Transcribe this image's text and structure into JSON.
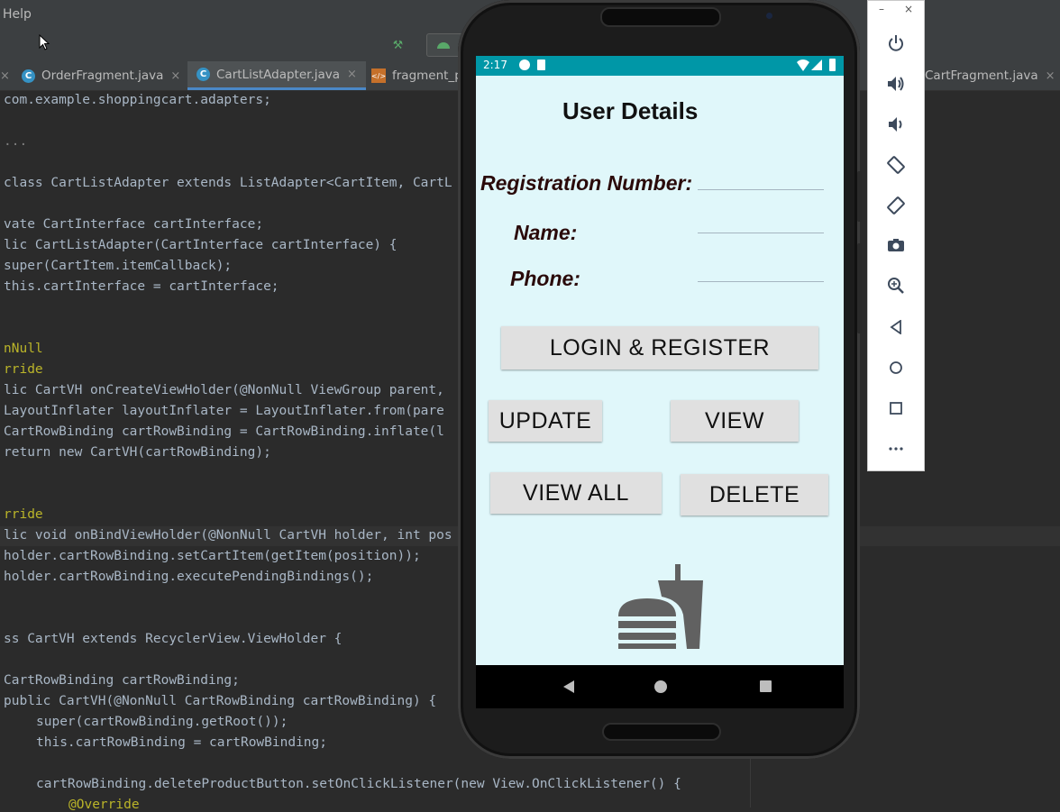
{
  "ide": {
    "menu": {
      "help": "Help"
    },
    "tabs": [
      {
        "label": "OrderFragment.java",
        "active": false
      },
      {
        "label": "CartListAdapter.java",
        "active": true
      },
      {
        "label": "fragment_p",
        "active": false
      }
    ],
    "tab_right": {
      "label": "CartFragment.java"
    },
    "code": [
      "com.example.shoppingcart.adapters;",
      "...",
      "class CartListAdapter extends ListAdapter<CartItem, CartL",
      "vate CartInterface cartInterface;",
      "lic CartListAdapter(CartInterface cartInterface) {",
      "super(CartItem.itemCallback);",
      "this.cartInterface = cartInterface;",
      "nNull",
      "rride",
      "lic CartVH onCreateViewHolder(@NonNull ViewGroup parent,",
      "LayoutInflater layoutInflater = LayoutInflater.from(pare",
      "CartRowBinding cartRowBinding = CartRowBinding.inflate(l",
      "return new CartVH(cartRowBinding);",
      "rride",
      "lic void onBindViewHolder(@NonNull CartVH holder, int pos",
      "holder.cartRowBinding.setCartItem(getItem(position));",
      "holder.cartRowBinding.executePendingBindings();",
      "ss CartVH extends RecyclerView.ViewHolder {",
      "CartRowBinding cartRowBinding;",
      "public CartVH(@NonNull CartRowBinding cartRowBinding) {",
      "super(cartRowBinding.getRoot());",
      "this.cartRowBinding = cartRowBinding;",
      "cartRowBinding.deleteProductButton.setOnClickListener(new View.OnClickListener() {",
      "@Override"
    ]
  },
  "phone": {
    "status_time": "2:17",
    "title": "User Details",
    "labels": {
      "registration": "Registration Number:",
      "name": "Name:",
      "phone": "Phone:"
    },
    "inputs": {
      "registration": "",
      "name": "",
      "phone": ""
    },
    "buttons": {
      "login_register": "LOGIN & REGISTER",
      "update": "UPDATE",
      "view": "VIEW",
      "view_all": "VIEW ALL",
      "delete": "DELETE"
    },
    "logo_icon": "fastfood-icon",
    "accent": "#0097a7",
    "background": "#e0f7fa"
  },
  "emulator_panel": {
    "window_controls": {
      "minimize": "–",
      "close": "×"
    },
    "buttons": [
      {
        "name": "power-icon",
        "glyph": "⏻"
      },
      {
        "name": "volume-up-icon",
        "glyph": "🔊"
      },
      {
        "name": "volume-down-icon",
        "glyph": "🔉"
      },
      {
        "name": "rotate-left-icon",
        "glyph": "⟲"
      },
      {
        "name": "rotate-right-icon",
        "glyph": "⟳"
      },
      {
        "name": "camera-icon",
        "glyph": "📷"
      },
      {
        "name": "zoom-icon",
        "glyph": "⊕"
      },
      {
        "name": "back-icon",
        "glyph": "◁"
      },
      {
        "name": "home-icon",
        "glyph": "○"
      },
      {
        "name": "overview-icon",
        "glyph": "□"
      },
      {
        "name": "more-icon",
        "glyph": "⋯"
      }
    ]
  }
}
